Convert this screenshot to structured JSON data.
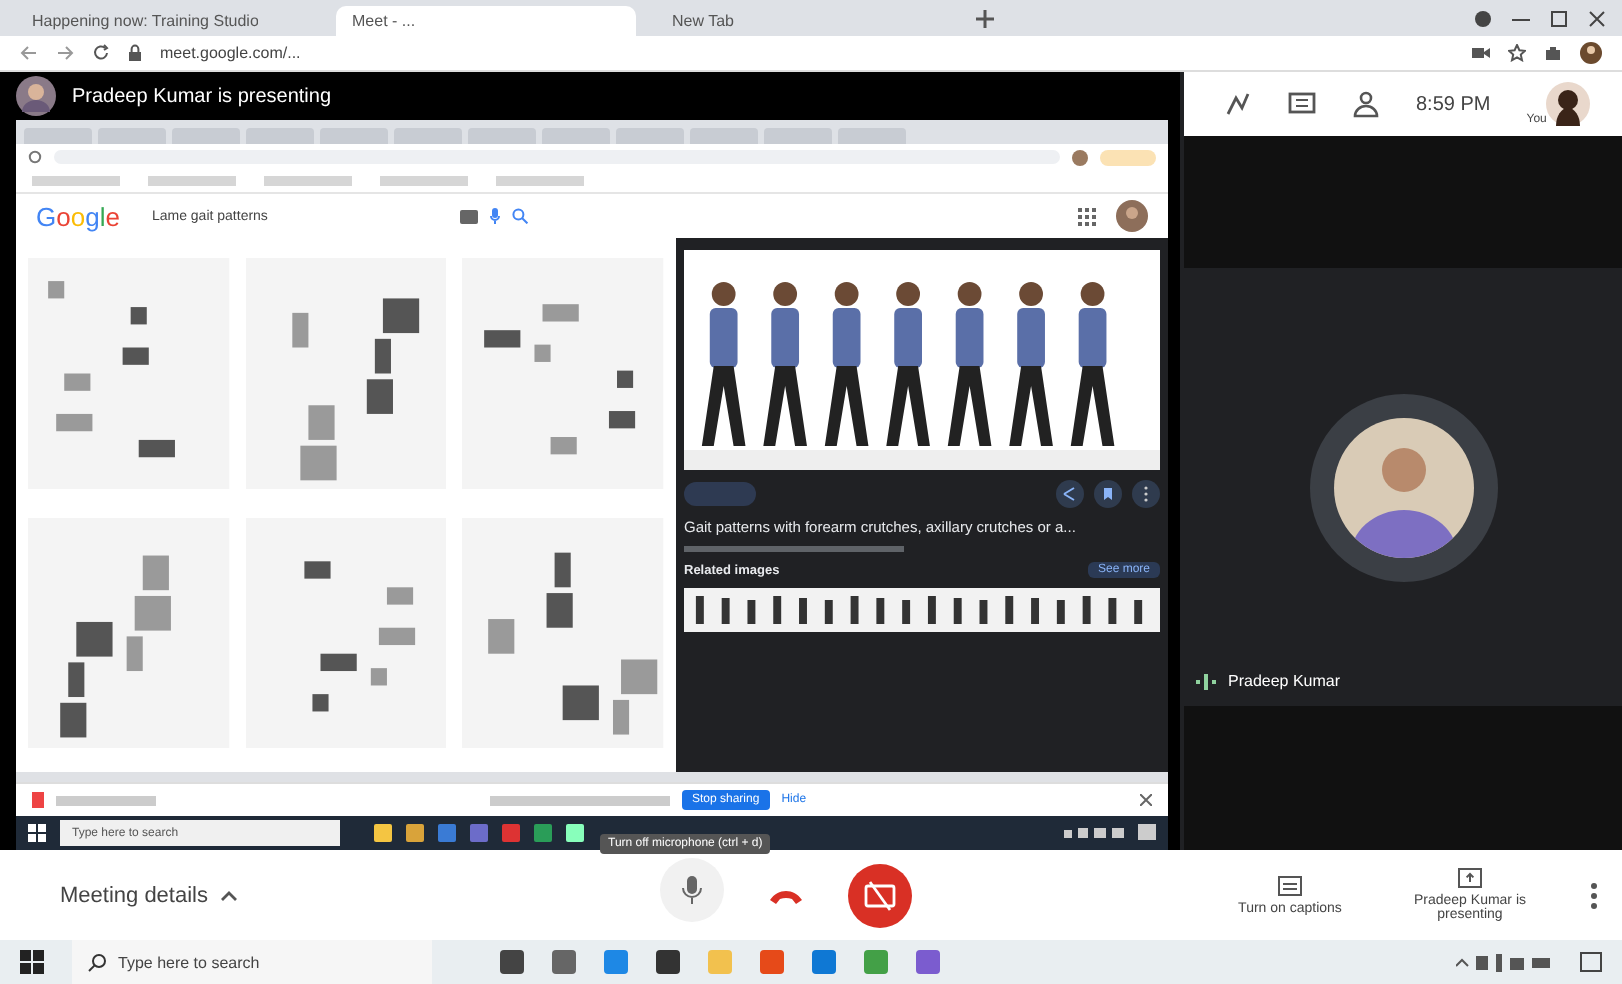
{
  "browser_tabs": [
    {
      "title": "Happening now: Training Studio",
      "selected": false
    },
    {
      "title": "Meet - ...",
      "selected": true
    },
    {
      "title": "New Tab",
      "selected": false
    }
  ],
  "address": "meet.google.com/...",
  "presenter_banner": "Pradeep Kumar is presenting",
  "shared_screen": {
    "logo": "Google",
    "search_query": "Lame gait patterns",
    "preview": {
      "title": "Gait patterns with forearm crutches, axillary crutches or a...",
      "related_label": "Related images",
      "see_more": "See more"
    },
    "stop_sharing": "Stop sharing",
    "hide": "Hide",
    "taskbar_search": "Type here to search"
  },
  "side_panel": {
    "time": "8:59 PM",
    "self_label": "You",
    "participant": "Pradeep Kumar"
  },
  "controls": {
    "meeting_details": "Meeting details",
    "mic_tooltip": "Turn off microphone (ctrl + d)",
    "captions": "Turn on captions",
    "presenting": "Pradeep Kumar is presenting"
  },
  "taskbar": {
    "search_placeholder": "Type here to search"
  }
}
